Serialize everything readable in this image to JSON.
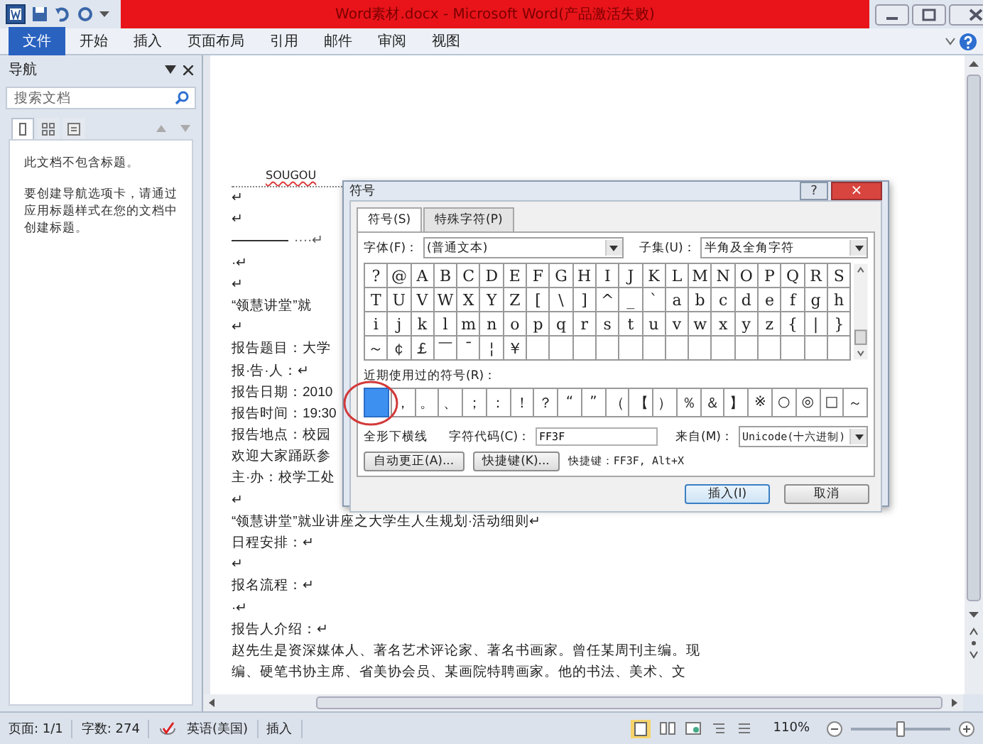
{
  "window": {
    "title": "Word素材.docx - Microsoft Word(产品激活失败)"
  },
  "ribbon_tabs": [
    {
      "label": "文件",
      "kind": "file"
    },
    {
      "label": "开始",
      "kind": "tab"
    },
    {
      "label": "插入",
      "kind": "tab"
    },
    {
      "label": "页面布局",
      "kind": "tab"
    },
    {
      "label": "引用",
      "kind": "tab"
    },
    {
      "label": "邮件",
      "kind": "tab"
    },
    {
      "label": "审阅",
      "kind": "tab"
    },
    {
      "label": "视图",
      "kind": "tab"
    }
  ],
  "navigation": {
    "title": "导航",
    "search": {
      "placeholder": "搜索文档"
    },
    "tabs": [
      {
        "kind": "headings",
        "selected": true
      },
      {
        "kind": "pages",
        "selected": false
      },
      {
        "kind": "results",
        "selected": false
      }
    ],
    "message": "此文档不包含标题。",
    "hint": "要创建导航选项卡，请通过应用标题样式在您的文档中创建标题。"
  },
  "document": {
    "header": "SOUGOU",
    "paragraphs": [
      {
        "kind": "text",
        "text": "↵"
      },
      {
        "kind": "text",
        "text": "↵"
      },
      {
        "kind": "rule",
        "text": "····↵"
      },
      {
        "kind": "text",
        "text": "·↵"
      },
      {
        "kind": "text",
        "text": "↵"
      },
      {
        "kind": "text",
        "text": "“领慧讲堂”就"
      },
      {
        "kind": "text",
        "text": "↵"
      },
      {
        "kind": "text",
        "text": "报告题目：大学"
      },
      {
        "kind": "text",
        "text": "报·告·人：↵"
      },
      {
        "kind": "text",
        "text": "报告日期：2010"
      },
      {
        "kind": "text",
        "text": "报告时间：19:30"
      },
      {
        "kind": "text",
        "text": "报告地点：校园"
      },
      {
        "kind": "text",
        "text": "欢迎大家踊跃参"
      },
      {
        "kind": "text",
        "text": "主·办：校学工处"
      },
      {
        "kind": "text",
        "text": "↵"
      },
      {
        "kind": "text",
        "text": "“领慧讲堂”就业讲座之大学生人生规划·活动细则↵"
      },
      {
        "kind": "text",
        "text": "日程安排：↵"
      },
      {
        "kind": "text",
        "text": "↵"
      },
      {
        "kind": "text",
        "text": "报名流程：↵"
      },
      {
        "kind": "text",
        "text": "·↵"
      },
      {
        "kind": "text",
        "text": "报告人介绍：↵"
      },
      {
        "kind": "text",
        "text": "赵先生是资深媒体人、著名艺术评论家、著名书画家。曾任某周刊主编。现"
      },
      {
        "kind": "text",
        "text": "编、硬笔书协主席、省美协会员、某画院特聘画家。他的书法、美术、文"
      }
    ]
  },
  "dialog": {
    "title": "符号",
    "help": "?",
    "close": "×",
    "tabs": [
      {
        "label": "符号(S)",
        "selected": true
      },
      {
        "label": "特殊字符(P)",
        "selected": false
      }
    ],
    "font": {
      "label": "字体(F)：",
      "value": "(普通文本)"
    },
    "subset": {
      "label": "子集(U)：",
      "value": "半角及全角字符"
    },
    "symbols": [
      [
        "?",
        "@",
        "A",
        "B",
        "C",
        "D",
        "E",
        "F",
        "G",
        "H",
        "I",
        "J",
        "K",
        "L",
        "M",
        "N",
        "O",
        "P",
        "Q",
        "R",
        "S"
      ],
      [
        "T",
        "U",
        "V",
        "W",
        "X",
        "Y",
        "Z",
        "[",
        "\\",
        "]",
        "^",
        "_",
        "`",
        "a",
        "b",
        "c",
        "d",
        "e",
        "f",
        "g",
        "h"
      ],
      [
        "i",
        "j",
        "k",
        "l",
        "m",
        "n",
        "o",
        "p",
        "q",
        "r",
        "s",
        "t",
        "u",
        "v",
        "w",
        "x",
        "y",
        "z",
        "{",
        "|",
        "}"
      ],
      [
        "～",
        "￠",
        "￡",
        "￣",
        "¯",
        "¦",
        "￥"
      ]
    ],
    "recent_label": "近期使用过的符号(R)：",
    "recent": [
      {
        "selected": true
      },
      {
        "symbol": "，",
        "selected": false
      },
      {
        "symbol": "。",
        "selected": false
      },
      {
        "symbol": "、",
        "selected": false
      },
      {
        "symbol": "；",
        "selected": false
      },
      {
        "symbol": "：",
        "selected": false
      },
      {
        "symbol": "！",
        "selected": false
      },
      {
        "symbol": "？",
        "selected": false
      },
      {
        "symbol": "“",
        "selected": false
      },
      {
        "symbol": "”",
        "selected": false
      },
      {
        "symbol": "（",
        "selected": false
      },
      {
        "symbol": "【",
        "selected": false
      },
      {
        "symbol": "）",
        "selected": false
      },
      {
        "symbol": "％",
        "selected": false
      },
      {
        "symbol": "＆",
        "selected": false
      },
      {
        "symbol": "】",
        "selected": false
      },
      {
        "symbol": "※",
        "selected": false
      },
      {
        "symbol": "○",
        "selected": false
      },
      {
        "symbol": "◎",
        "selected": false
      },
      {
        "symbol": "□",
        "selected": false
      },
      {
        "symbol": "～",
        "selected": false
      }
    ],
    "char_name": "全形下横线",
    "code": {
      "label": "字符代码(C)：",
      "value": "FF3F"
    },
    "from": {
      "label": "来自(M)：",
      "value": "Unicode(十六进制)"
    },
    "autocorrect_button": "自动更正(A)...",
    "shortcut_button": "快捷键(K)...",
    "shortcut_text": "快捷键：FF3F, Alt+X",
    "insert_button": "插入(I)",
    "cancel_button": "取消"
  },
  "status_bar": {
    "page": "页面: 1/1",
    "words": "字数: 274",
    "language": "英语(美国)",
    "mode": "插入",
    "zoom": "110%",
    "zoom_slider": {
      "level": 0.5
    }
  }
}
